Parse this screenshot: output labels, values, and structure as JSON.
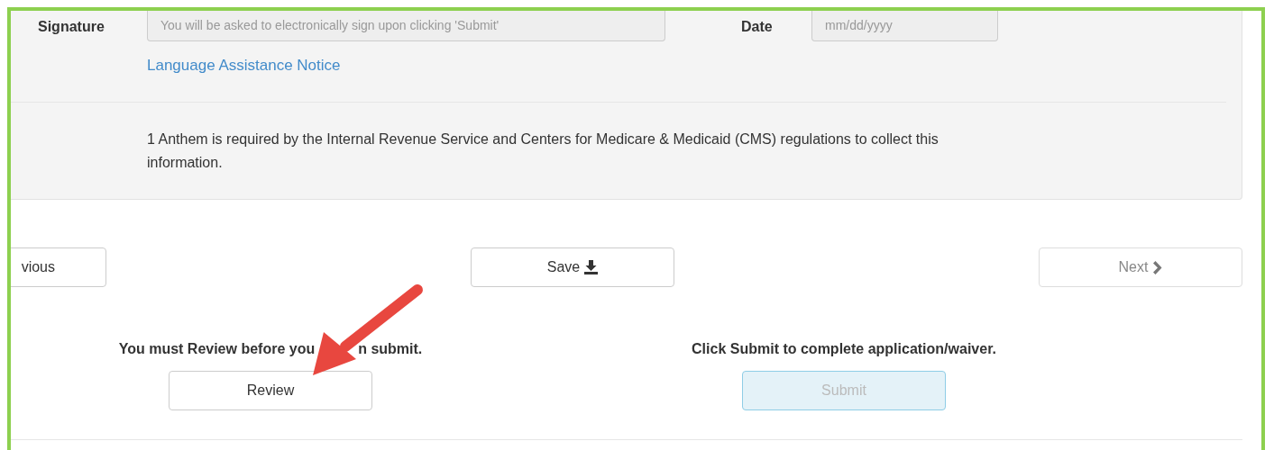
{
  "form": {
    "signature": {
      "label": "Signature",
      "placeholder": "You will be asked to electronically sign upon clicking 'Submit'",
      "disabled": true
    },
    "date": {
      "label": "Date",
      "placeholder": "mm/dd/yyyy",
      "disabled": true
    },
    "link": "Language Assistance Notice",
    "footnote": "1 Anthem is required by the Internal Revenue Service and Centers for Medicare & Medicaid (CMS) regulations to collect this information."
  },
  "navigation": [
    {
      "kind": "previous",
      "label": "vious",
      "disabled": false
    },
    {
      "kind": "save",
      "label": "Save",
      "disabled": false
    },
    {
      "kind": "next",
      "label": "Next",
      "disabled": true
    }
  ],
  "actions": [
    {
      "message": [
        "You must Review before you",
        "n submit."
      ],
      "button": "Review",
      "disabled": false
    },
    {
      "message": [
        "Click Submit to complete application/waiver."
      ],
      "button": "Submit",
      "disabled": true
    }
  ],
  "annotation": {
    "kind": "arrow"
  }
}
